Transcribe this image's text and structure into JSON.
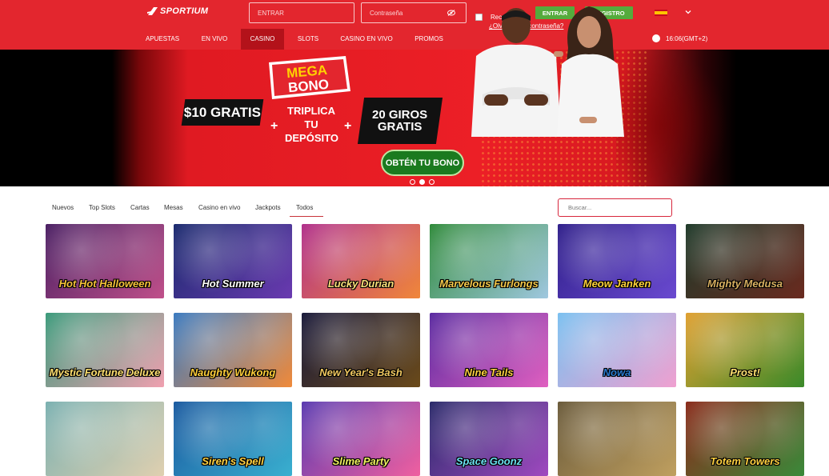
{
  "brand": {
    "name": "SPORTIUM"
  },
  "login": {
    "user_placeholder": "ENTRAR",
    "password_placeholder": "Contraseña",
    "remember_label": "Recuérdame",
    "forgot_label": "¿Olvidaste tu contraseña?",
    "enter_label": "ENTRAR",
    "register_label": "REGISTRO"
  },
  "nav": {
    "items": [
      "APUESTAS",
      "EN VIVO",
      "CASINO",
      "SLOTS",
      "CASINO EN VIVO",
      "PROMOS"
    ],
    "active": "CASINO",
    "clock": "16:06(GMT+2)"
  },
  "banner": {
    "badge_line1": "MEGA",
    "badge_line2": "BONO",
    "promo_1": "$10 GRATIS",
    "promo_2_line1": "TRIPLICA",
    "promo_2_line2": "TU",
    "promo_2_line3": "DEPÓSITO",
    "promo_3_line1": "20 GIROS",
    "promo_3_line2": "GRATIS",
    "plus": "+",
    "cta": "OBTÉN TU BONO",
    "slides": 3,
    "active_slide": 2
  },
  "categories": {
    "tabs": [
      "Nuevos",
      "Top Slots",
      "Cartas",
      "Mesas",
      "Casino en vivo",
      "Jackpots",
      "Todos"
    ],
    "active": "Todos",
    "search_placeholder": "Buscar..."
  },
  "games": [
    {
      "title": "Hot Hot Halloween",
      "bg1": "#4a1f63",
      "bg2": "#c0508a",
      "color": "#f7c23a"
    },
    {
      "title": "Hot Summer",
      "bg1": "#1a2a6e",
      "bg2": "#6a3ab0",
      "color": "#ffffff"
    },
    {
      "title": "Lucky Durian",
      "bg1": "#b02f8a",
      "bg2": "#f0873a",
      "color": "#fbe07a"
    },
    {
      "title": "Marvelous Furlongs",
      "bg1": "#2f8a3a",
      "bg2": "#a0c8e0",
      "color": "#f4c84a"
    },
    {
      "title": "Meow Janken",
      "bg1": "#2f1f8a",
      "bg2": "#6a4ad0",
      "color": "#ffd23a"
    },
    {
      "title": "Mighty Medusa",
      "bg1": "#1f3a2a",
      "bg2": "#6a2a1f",
      "color": "#d8b060"
    },
    {
      "title": "Mystic Fortune Deluxe",
      "bg1": "#3a9a7a",
      "bg2": "#f0a0b0",
      "color": "#ffe070"
    },
    {
      "title": "Naughty Wukong",
      "bg1": "#3a7ac0",
      "bg2": "#f08a3a",
      "color": "#ffcf3a"
    },
    {
      "title": "New Year's Bash",
      "bg1": "#1a1a3a",
      "bg2": "#6a4a1a",
      "color": "#f0c860"
    },
    {
      "title": "Nine Tails",
      "bg1": "#5a2aa0",
      "bg2": "#e060c0",
      "color": "#ffd040"
    },
    {
      "title": "Nowa",
      "bg1": "#7ac0f0",
      "bg2": "#f0a0d0",
      "color": "#2a7ad0"
    },
    {
      "title": "Prost!",
      "bg1": "#e0a030",
      "bg2": "#3a8a2a",
      "color": "#ffe070"
    },
    {
      "title": "",
      "bg1": "#7ab0b0",
      "bg2": "#e0d0b0",
      "color": "#ffffff"
    },
    {
      "title": "Siren's Spell",
      "bg1": "#1a5aa0",
      "bg2": "#3ab0d0",
      "color": "#ffd040"
    },
    {
      "title": "Slime Party",
      "bg1": "#5a3ab0",
      "bg2": "#f060a0",
      "color": "#f0f060"
    },
    {
      "title": "Space Goonz",
      "bg1": "#2a2a6a",
      "bg2": "#a04ac0",
      "color": "#6ae0f0"
    },
    {
      "title": "",
      "bg1": "#6a5a3a",
      "bg2": "#c0a060",
      "color": "#ffffff"
    },
    {
      "title": "Totem Towers",
      "bg1": "#8a2a1a",
      "bg2": "#3a8a3a",
      "color": "#ffd040"
    }
  ],
  "colors": {
    "header_red": "#e3262e",
    "nav_active": "#b3121a",
    "button_green": "#55ab3c",
    "cta_green": "#1b7a1f",
    "search_border": "#d7263c"
  }
}
